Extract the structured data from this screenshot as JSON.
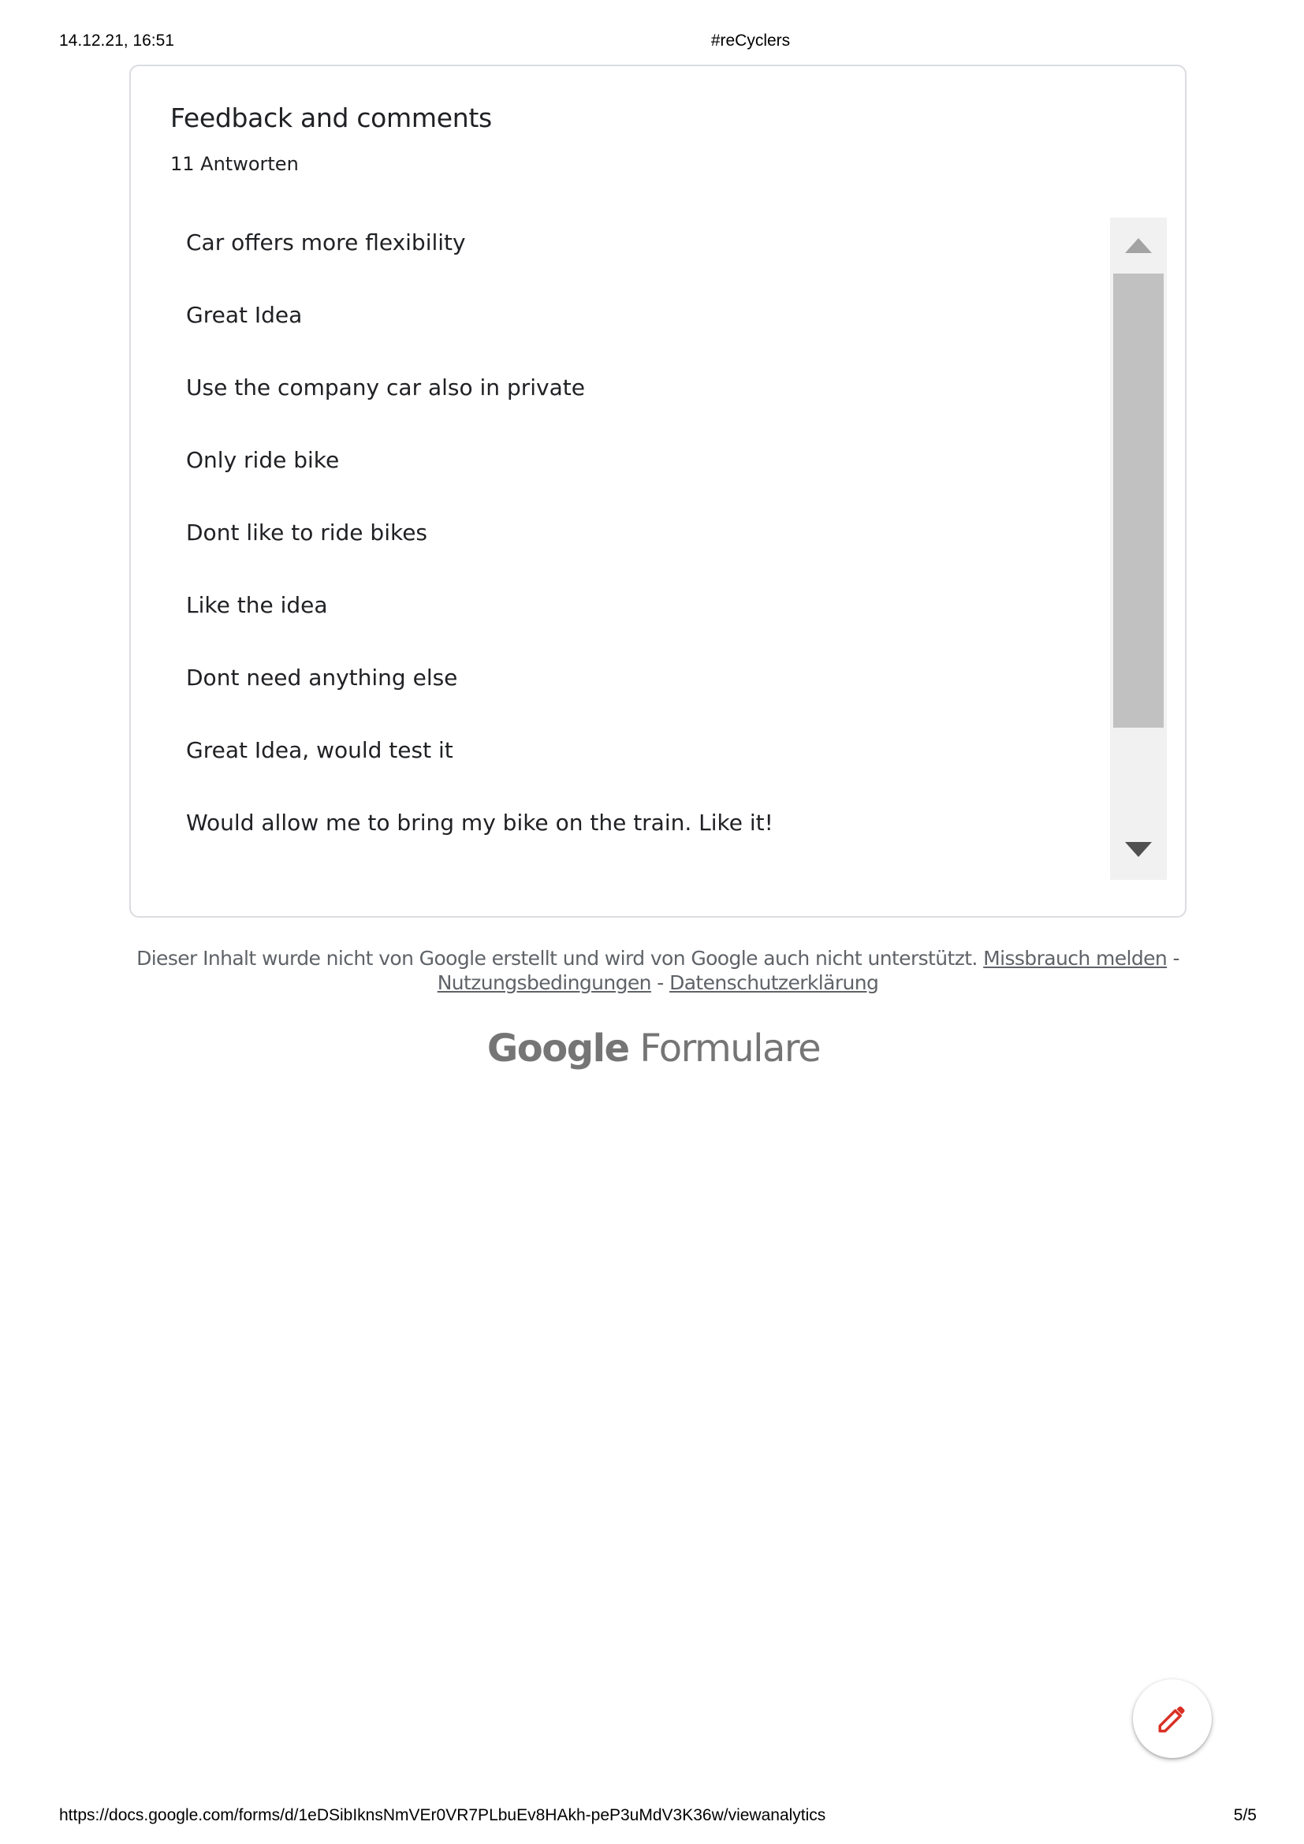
{
  "print_header": {
    "datetime": "14.12.21, 16:51",
    "title": "#reCyclers"
  },
  "card": {
    "title": "Feedback and comments",
    "response_count": "11 Antworten",
    "responses": [
      "Car offers more flexibility",
      "Great Idea",
      "Use the company car also in private",
      "Only ride bike",
      "Dont like to ride bikes",
      "Like the idea",
      "Dont need anything else",
      "Great Idea, would test it",
      "Would allow me to bring my bike on the train. Like it!"
    ]
  },
  "footer": {
    "disclaimer": "Dieser Inhalt wurde nicht von Google erstellt und wird von Google auch nicht unterstützt.",
    "report_abuse": "Missbrauch melden",
    "terms": "Nutzungsbedingungen",
    "privacy": "Datenschutzerklärung",
    "separator": "-",
    "logo_brand": "Google",
    "logo_product": "Formulare"
  },
  "fab": {
    "icon": "pencil-icon",
    "color": "#d93025"
  },
  "print_footer": {
    "url": "https://docs.google.com/forms/d/1eDSibIknsNmVEr0VR7PLbuEv8HAkh-peP3uMdV3K36w/viewanalytics",
    "page": "5/5"
  }
}
